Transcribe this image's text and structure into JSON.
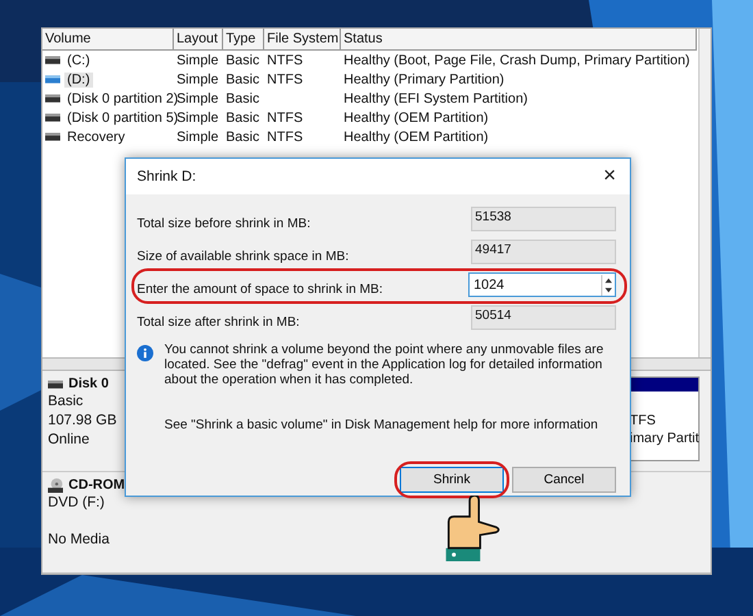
{
  "volume_table": {
    "columns": [
      "Volume",
      "Layout",
      "Type",
      "File System",
      "Status"
    ],
    "rows": [
      {
        "volume": "(C:)",
        "layout": "Simple",
        "type": "Basic",
        "file_system": "NTFS",
        "status": "Healthy (Boot, Page File, Crash Dump, Primary Partition)",
        "selected": false
      },
      {
        "volume": "(D:)",
        "layout": "Simple",
        "type": "Basic",
        "file_system": "NTFS",
        "status": "Healthy (Primary Partition)",
        "selected": true
      },
      {
        "volume": "(Disk 0 partition 2)",
        "layout": "Simple",
        "type": "Basic",
        "status": "Healthy (EFI System Partition)",
        "selected": false
      },
      {
        "volume": "(Disk 0 partition 5)",
        "layout": "Simple",
        "type": "Basic",
        "file_system": "NTFS",
        "status": "Healthy (OEM Partition)",
        "selected": false
      },
      {
        "volume": "Recovery",
        "layout": "Simple",
        "type": "Basic",
        "file_system": "NTFS",
        "status": "Healthy (OEM Partition)",
        "selected": false
      }
    ]
  },
  "disks": [
    {
      "kind": "disk",
      "name": "Disk 0",
      "lines": [
        "Basic",
        "107.98 GB",
        "Online"
      ],
      "partition_lines": [
        "TFS",
        "imary Partit"
      ]
    },
    {
      "kind": "cdrom",
      "name": "CD-ROM",
      "lines": [
        "DVD (F:)",
        "No Media"
      ]
    }
  ],
  "dialog": {
    "title": "Shrink D:",
    "close": "×",
    "fields": [
      {
        "kind": "readonly",
        "label": "Total size before shrink in MB:",
        "value": "51538",
        "highlighted": false
      },
      {
        "kind": "readonly",
        "label": "Size of available shrink space in MB:",
        "value": "49417",
        "highlighted": false
      },
      {
        "kind": "spin",
        "label": "Enter the amount of space to shrink in MB:",
        "value": "1024",
        "highlighted": true
      },
      {
        "kind": "readonly",
        "label": "Total size after shrink in MB:",
        "value": "50514",
        "highlighted": false
      }
    ],
    "info": "You cannot shrink a volume beyond the point where any unmovable files are located. See the \"defrag\" event in the Application log for detailed information about the operation when it has completed.",
    "help": "See \"Shrink a basic volume\" in Disk Management help for more information",
    "buttons": [
      {
        "label": "Shrink",
        "default": true,
        "highlighted": true
      },
      {
        "label": "Cancel",
        "default": false,
        "highlighted": false
      }
    ]
  }
}
